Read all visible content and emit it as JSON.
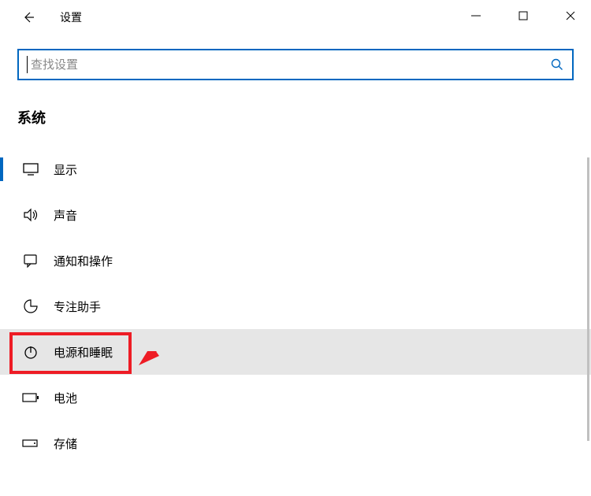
{
  "titlebar": {
    "title": "设置"
  },
  "search": {
    "placeholder": "查找设置"
  },
  "section": {
    "title": "系统"
  },
  "nav": {
    "items": [
      {
        "label": "显示",
        "icon": "display-icon"
      },
      {
        "label": "声音",
        "icon": "sound-icon"
      },
      {
        "label": "通知和操作",
        "icon": "notification-icon"
      },
      {
        "label": "专注助手",
        "icon": "focus-icon"
      },
      {
        "label": "电源和睡眠",
        "icon": "power-icon"
      },
      {
        "label": "电池",
        "icon": "battery-icon"
      },
      {
        "label": "存储",
        "icon": "storage-icon"
      }
    ]
  },
  "annotation": {
    "highlight_index": 4,
    "arrow_color": "#ee1c25"
  }
}
